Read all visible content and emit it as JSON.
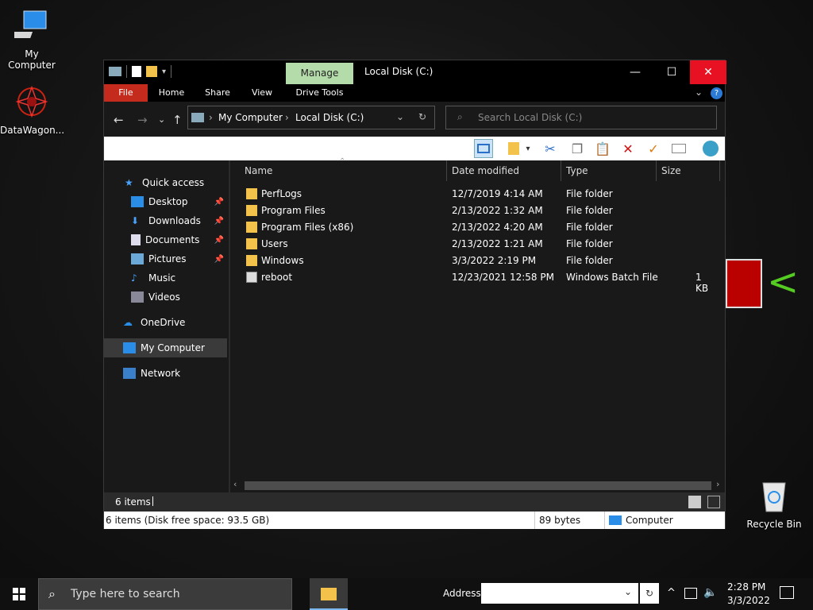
{
  "desktop": {
    "icons": [
      {
        "label": "My Computer"
      },
      {
        "label": "DataWagon..."
      },
      {
        "label": "Recycle Bin"
      }
    ]
  },
  "window": {
    "title": "Local Disk (C:)",
    "manage_tab": "Manage",
    "ribbon_tabs": [
      "File",
      "Home",
      "Share",
      "View",
      "Drive Tools"
    ],
    "address": {
      "crumbs": [
        "My Computer",
        "Local Disk (C:)"
      ]
    },
    "search": {
      "placeholder": "Search Local Disk (C:)"
    },
    "nav": {
      "quick_access": "Quick access",
      "items": [
        "Desktop",
        "Downloads",
        "Documents",
        "Pictures",
        "Music",
        "Videos"
      ],
      "onedrive": "OneDrive",
      "my_computer": "My Computer",
      "network": "Network"
    },
    "columns": [
      "Name",
      "Date modified",
      "Type",
      "Size"
    ],
    "rows": [
      {
        "name": "PerfLogs",
        "date": "12/7/2019 4:14 AM",
        "type": "File folder",
        "size": ""
      },
      {
        "name": "Program Files",
        "date": "2/13/2022 1:32 AM",
        "type": "File folder",
        "size": ""
      },
      {
        "name": "Program Files (x86)",
        "date": "2/13/2022 4:20 AM",
        "type": "File folder",
        "size": ""
      },
      {
        "name": "Users",
        "date": "2/13/2022 1:21 AM",
        "type": "File folder",
        "size": ""
      },
      {
        "name": "Windows",
        "date": "3/3/2022 2:19 PM",
        "type": "File folder",
        "size": ""
      },
      {
        "name": "reboot",
        "date": "12/23/2021 12:58 PM",
        "type": "Windows Batch File",
        "size": "1 KB"
      }
    ],
    "item_count": "6 items",
    "status": {
      "left": "6 items (Disk free space: 93.5 GB)",
      "size": "89 bytes",
      "location": "Computer"
    }
  },
  "taskbar": {
    "search_placeholder": "Type here to search",
    "address_label": "Address",
    "time": "2:28 PM",
    "date": "3/3/2022"
  },
  "colors": {
    "close": "#e81123",
    "file_tab": "#c42b1c",
    "manage_tab": "#b4dcab",
    "folder": "#f3c24a"
  }
}
